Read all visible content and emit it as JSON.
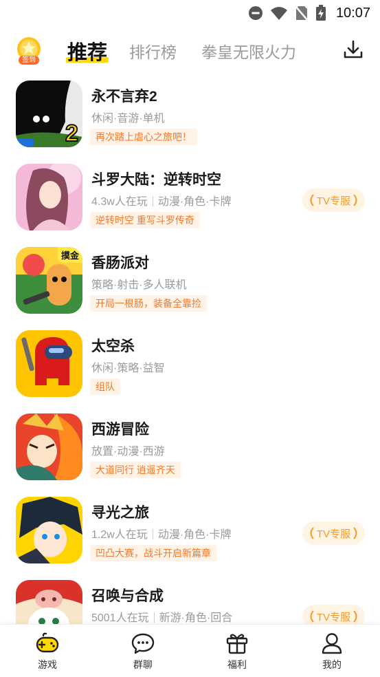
{
  "status_bar": {
    "time": "10:07"
  },
  "header": {
    "signin_label": "签到",
    "tabs": [
      {
        "label": "推荐",
        "active": true
      },
      {
        "label": "排行榜",
        "active": false
      },
      {
        "label": "拳皇无限火力",
        "active": false
      }
    ]
  },
  "games": [
    {
      "title": "永不言弃2",
      "meta_parts": [
        "休闲·音游·单机"
      ],
      "tagline": "再次踏上虐心之旅吧！",
      "tv_badge": "",
      "icon_badge": ""
    },
    {
      "title": "斗罗大陆：逆转时空",
      "meta_parts": [
        "4.3w人在玩",
        "动漫·角色·卡牌"
      ],
      "tagline": "逆转时空 重写斗罗传奇",
      "tv_badge": "TV专服",
      "icon_badge": ""
    },
    {
      "title": "香肠派对",
      "meta_parts": [
        "策略·射击·多人联机"
      ],
      "tagline": "开局一根肠，装备全靠捡",
      "tv_badge": "",
      "icon_badge": "摸金"
    },
    {
      "title": "太空杀",
      "meta_parts": [
        "休闲·策略·益智"
      ],
      "tagline": "组队",
      "tv_badge": "",
      "icon_badge": ""
    },
    {
      "title": "西游冒险",
      "meta_parts": [
        "放置·动漫·西游"
      ],
      "tagline": "大道同行 逍遥齐天",
      "tv_badge": "",
      "icon_badge": ""
    },
    {
      "title": "寻光之旅",
      "meta_parts": [
        "1.2w人在玩",
        "动漫·角色·卡牌"
      ],
      "tagline": "凹凸大赛，战斗开启新篇章",
      "tv_badge": "TV专服",
      "icon_badge": ""
    },
    {
      "title": "召唤与合成",
      "meta_parts": [
        "5001人在玩",
        "新游·角色·回合"
      ],
      "tagline": "",
      "tv_badge": "TV专服",
      "icon_badge": ""
    }
  ],
  "bottom_nav": [
    {
      "label": "游戏",
      "icon": "gamepad-icon",
      "active": true
    },
    {
      "label": "群聊",
      "icon": "chat-icon",
      "active": false
    },
    {
      "label": "福利",
      "icon": "gift-icon",
      "active": false
    },
    {
      "label": "我的",
      "icon": "user-icon",
      "active": false
    }
  ],
  "colors": {
    "accent_yellow": "#ffd900",
    "tag_orange": "#f07a2a",
    "tag_bg": "#fff2e6",
    "tv_badge_text": "#f39a27"
  }
}
